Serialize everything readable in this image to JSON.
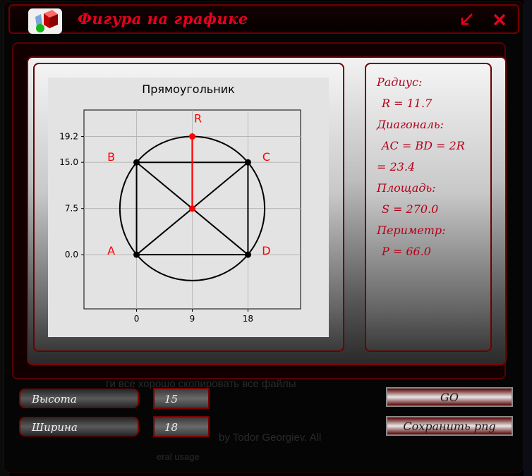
{
  "window": {
    "title": "Фигура на графике"
  },
  "backdrop": {
    "line1": "ги все хорошо скопировать все файлы",
    "line2": "by Todor Georgiev. All",
    "line3": "eral usage"
  },
  "chart_data": {
    "type": "scatter",
    "title": "Прямоугольник",
    "xlabel": "",
    "ylabel": "",
    "x_ticks": [
      "0",
      "9",
      "18"
    ],
    "y_ticks": [
      "0.0",
      "7.5",
      "15.0",
      "19.2"
    ],
    "xlim": [
      -8.5,
      26.5
    ],
    "ylim": [
      -8.8,
      23.5
    ],
    "grid": true,
    "vertices": [
      {
        "label": "A",
        "x": 0,
        "y": 0
      },
      {
        "label": "B",
        "x": 0,
        "y": 15
      },
      {
        "label": "C",
        "x": 18,
        "y": 15
      },
      {
        "label": "D",
        "x": 18,
        "y": 0
      }
    ],
    "center": {
      "x": 9,
      "y": 7.5
    },
    "radius_point": {
      "label": "R",
      "x": 9,
      "y": 19.2
    },
    "circle": {
      "cx": 9,
      "cy": 7.5,
      "r": 11.7
    },
    "colors": {
      "shape": "#000000",
      "radius": "#ff0000",
      "labels": "#ff0000"
    }
  },
  "info": {
    "radius_label": "Радиус:",
    "radius_value": "R = 11.7",
    "diagonal_label": "Диагональ:",
    "diagonal_value": "AC = BD = 2R",
    "diagonal_value2": "= 23.4",
    "area_label": "Площадь:",
    "area_value": "S = 270.0",
    "perimeter_label": "Периметр:",
    "perimeter_value": "P = 66.0"
  },
  "controls": {
    "height_label": "Высота",
    "height_value": "15",
    "width_label": "Ширина",
    "width_value": "18",
    "go_label": "GO",
    "save_label": "Сохранить png"
  },
  "colors": {
    "accent": "#e8001c",
    "frame": "#7a0000"
  }
}
